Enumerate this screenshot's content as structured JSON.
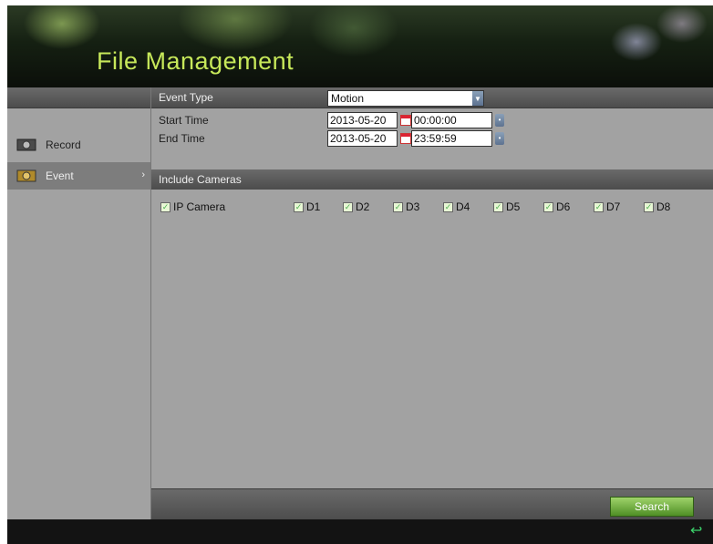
{
  "header": {
    "title": "File Management"
  },
  "sidebar": {
    "items": [
      {
        "label": "Record",
        "icon": "record-icon"
      },
      {
        "label": "Event",
        "icon": "event-icon",
        "active": true,
        "chevron": "›"
      }
    ]
  },
  "form": {
    "event_type_label": "Event Type",
    "event_type_value": "Motion",
    "start_time_label": "Start Time",
    "start_date": "2013-05-20",
    "start_time": "00:00:00",
    "end_time_label": "End Time",
    "end_date": "2013-05-20",
    "end_time": "23:59:59"
  },
  "cameras": {
    "header": "Include Cameras",
    "all_label": "IP Camera",
    "items": [
      "D1",
      "D2",
      "D3",
      "D4",
      "D5",
      "D6",
      "D7",
      "D8"
    ]
  },
  "actions": {
    "search_label": "Search"
  },
  "colors": {
    "title": "#c7e85a",
    "panel": "#a2a2a2",
    "search": "#5da82f"
  }
}
